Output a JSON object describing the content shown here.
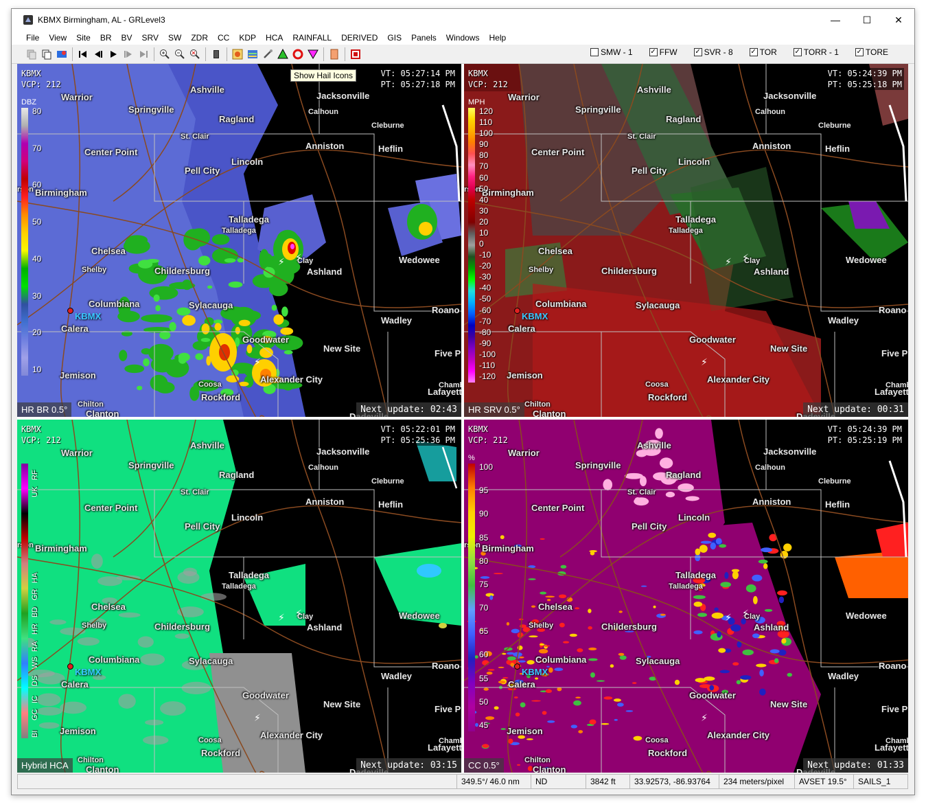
{
  "window": {
    "title": "KBMX Birmingham, AL - GRLevel3",
    "minimize": "—",
    "maximize": "☐",
    "close": "✕"
  },
  "menu": [
    "File",
    "View",
    "Site",
    "BR",
    "BV",
    "SRV",
    "SW",
    "ZDR",
    "CC",
    "KDP",
    "HCA",
    "RAINFALL",
    "DERIVED",
    "GIS",
    "Panels",
    "Windows",
    "Help"
  ],
  "warnings": [
    {
      "label": "SMW - 1",
      "checked": false
    },
    {
      "label": "FFW",
      "checked": true
    },
    {
      "label": "SVR - 8",
      "checked": true
    },
    {
      "label": "TOR",
      "checked": true
    },
    {
      "label": "TORR - 1",
      "checked": true
    },
    {
      "label": "TORE",
      "checked": true
    }
  ],
  "tooltip": "Show Hail Icons",
  "cities": [
    {
      "name": "Ashville"
    },
    {
      "name": "Warrior"
    },
    {
      "name": "Jacksonville"
    },
    {
      "name": "Springville"
    },
    {
      "name": "Calhoun",
      "small": true
    },
    {
      "name": "Ragland"
    },
    {
      "name": "Cleburne",
      "small": true
    },
    {
      "name": "St. Clair",
      "small": true
    },
    {
      "name": "Anniston"
    },
    {
      "name": "Heflin"
    },
    {
      "name": "Center Point"
    },
    {
      "name": "Lincoln"
    },
    {
      "name": "Pell City"
    },
    {
      "name": "Birmingham"
    },
    {
      "name": "Talladega"
    },
    {
      "name": "Talladega",
      "small": true
    },
    {
      "name": "Chelsea"
    },
    {
      "name": "Wedowee"
    },
    {
      "name": "Clay",
      "small": true
    },
    {
      "name": "Shelby",
      "small": true
    },
    {
      "name": "Childersburg"
    },
    {
      "name": "Ashland"
    },
    {
      "name": "Columbiana"
    },
    {
      "name": "Sylacauga"
    },
    {
      "name": "Roano"
    },
    {
      "name": "Calera"
    },
    {
      "name": "Wadley"
    },
    {
      "name": "Goodwater"
    },
    {
      "name": "New Site"
    },
    {
      "name": "Five P"
    },
    {
      "name": "Jemison"
    },
    {
      "name": "Alexander City"
    },
    {
      "name": "Coosa",
      "small": true
    },
    {
      "name": "Chamb",
      "small": true
    },
    {
      "name": "Rockford"
    },
    {
      "name": "Lafayett"
    },
    {
      "name": "Chilton",
      "small": true
    },
    {
      "name": "Clanton"
    },
    {
      "name": "Dadeville"
    },
    {
      "name": "rson",
      "small": true
    }
  ],
  "radar_site": "KBMX",
  "panes": [
    {
      "site": "KBMX",
      "vcp": "VCP: 212",
      "vt": "VT: 05:27:14 PM",
      "pt": "PT: 05:27:18 PM",
      "product": "HR BR 0.5°",
      "next": "Next update: 02:43",
      "unit": "DBZ",
      "legend": [
        "80",
        "70",
        "60",
        "50",
        "40",
        "30",
        "20",
        "10"
      ]
    },
    {
      "site": "KBMX",
      "vcp": "VCP: 212",
      "vt": "VT: 05:24:39 PM",
      "pt": "PT: 05:25:18 PM",
      "product": "HR SRV 0.5°",
      "next": "Next update: 00:31",
      "unit": "MPH",
      "legend": [
        "120",
        "110",
        "100",
        "90",
        "80",
        "70",
        "60",
        "50",
        "40",
        "30",
        "20",
        "10",
        "0",
        "-10",
        "-20",
        "-30",
        "-40",
        "-50",
        "-60",
        "-70",
        "-80",
        "-90",
        "-100",
        "-110",
        "-120"
      ]
    },
    {
      "site": "KBMX",
      "vcp": "VCP: 212",
      "vt": "VT: 05:22:01 PM",
      "pt": "PT: 05:25:36 PM",
      "product": "Hybrid HCA",
      "next": "Next update: 03:15",
      "unit": "",
      "legend": [
        "RF",
        "UK",
        "HA",
        "GR",
        "BD",
        "HR",
        "RA",
        "WS",
        "DS",
        "IC",
        "GC",
        "BI"
      ]
    },
    {
      "site": "KBMX",
      "vcp": "VCP: 212",
      "vt": "VT: 05:24:39 PM",
      "pt": "PT: 05:25:19 PM",
      "product": "CC 0.5°",
      "next": "Next update: 01:33",
      "unit": "%",
      "legend": [
        "100",
        "95",
        "90",
        "85",
        "80",
        "75",
        "70",
        "65",
        "60",
        "55",
        "50",
        "45"
      ]
    }
  ],
  "status": [
    "349.5°/ 46.0 nm",
    "ND",
    "3842 ft",
    "33.92573, -86.93764",
    "234 meters/pixel",
    "AVSET 19.5°",
    "SAILS_1"
  ]
}
